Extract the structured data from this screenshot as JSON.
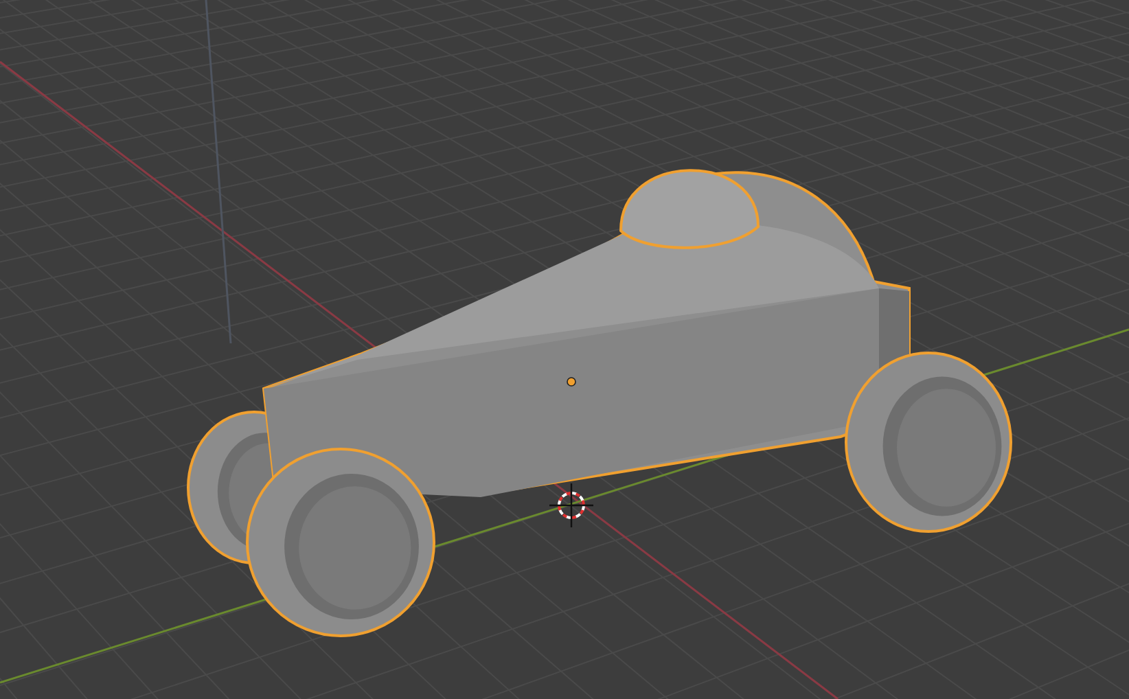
{
  "object": {
    "selected": true
  }
}
